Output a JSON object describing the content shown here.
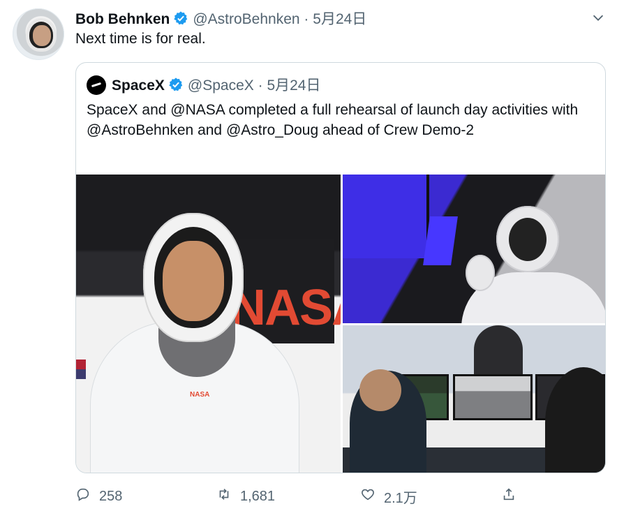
{
  "tweet": {
    "author_name": "Bob Behnken",
    "handle": "@AstroBehnken",
    "separator": "·",
    "date": "5月24日",
    "text": "Next time is for real."
  },
  "quoted_tweet": {
    "author_name": "SpaceX",
    "handle": "@SpaceX",
    "separator": "·",
    "date": "5月24日",
    "text": "SpaceX and @NASA completed a full rehearsal of launch day activities with @AstroBehnken and @Astro_Doug ahead of Crew Demo-2",
    "photo_1": {
      "wall_text": "NASA",
      "suit_badge": "NASA"
    }
  },
  "actions": {
    "reply_count": "258",
    "retweet_count": "1,681",
    "like_count": "2.1万"
  },
  "icons": {
    "verified": "verified-badge-icon",
    "more": "chevron-down-icon",
    "reply": "reply-icon",
    "retweet": "retweet-icon",
    "like": "heart-icon",
    "share": "share-icon"
  },
  "colors": {
    "verified": "#1d9bf0",
    "secondary_text": "#536471",
    "border": "#cfd9de"
  }
}
